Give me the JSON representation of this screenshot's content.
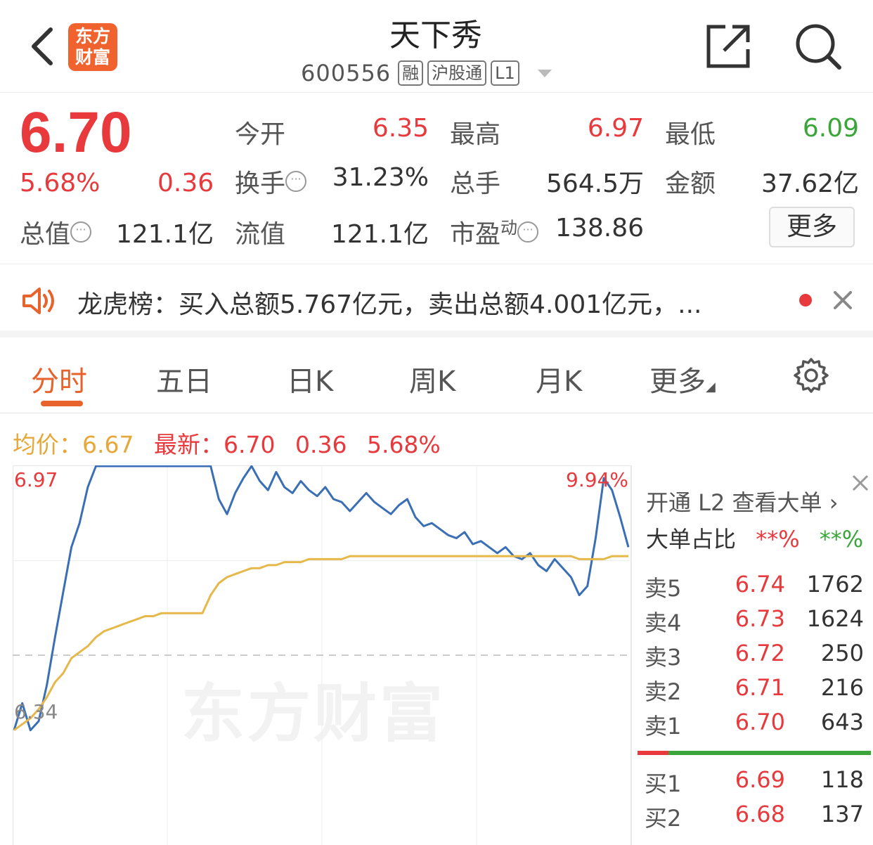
{
  "header": {
    "logo_line1": "东方",
    "logo_line2": "财富",
    "title": "天下秀",
    "code": "600556",
    "tags": [
      "融",
      "沪股通",
      "L1"
    ]
  },
  "quote": {
    "price": "6.70",
    "change_pct": "5.68%",
    "change": "0.36",
    "fields": [
      {
        "label": "今开",
        "value": "6.35",
        "color": "#e8393d"
      },
      {
        "label": "最高",
        "value": "6.97",
        "color": "#e8393d"
      },
      {
        "label": "最低",
        "value": "6.09",
        "color": "#3aa63a"
      },
      {
        "label": "换手",
        "value": "31.23%",
        "color": "#333333"
      },
      {
        "label": "总手",
        "value": "564.5万",
        "color": "#333333"
      },
      {
        "label": "金额",
        "value": "37.62亿",
        "color": "#333333"
      },
      {
        "label": "总值",
        "value": "121.1亿",
        "color": "#333333"
      },
      {
        "label": "流值",
        "value": "121.1亿",
        "color": "#333333"
      },
      {
        "label": "市盈",
        "label_sup": "动",
        "value": "138.86",
        "color": "#333333"
      }
    ],
    "more_label": "更多"
  },
  "banner": {
    "text": "龙虎榜：买入总额5.767亿元，卖出总额4.001亿元，..."
  },
  "tabs": {
    "items": [
      "分时",
      "五日",
      "日K",
      "周K",
      "月K",
      "更多"
    ],
    "active": "分时"
  },
  "infoline": {
    "avg_label": "均价：",
    "avg_value": "6.67",
    "latest_label": "最新：",
    "latest_value": "6.70",
    "latest_change": "0.36",
    "latest_pct": "5.68%"
  },
  "chart_data": {
    "type": "line",
    "top_label": "6.97",
    "top_pct_label": "9.94%",
    "base_label": "6.34",
    "watermark": "东方财富",
    "ylim": [
      5.71,
      6.97
    ],
    "prev_close": 6.34,
    "series": [
      {
        "color": "#3a6fb5",
        "values": [
          6.09,
          6.18,
          6.09,
          6.12,
          6.24,
          6.4,
          6.55,
          6.7,
          6.78,
          6.9,
          6.97,
          6.97,
          6.97,
          6.97,
          6.97,
          6.97,
          6.97,
          6.97,
          6.97,
          6.97,
          6.97,
          6.97,
          6.97,
          6.97,
          6.97,
          6.86,
          6.81,
          6.88,
          6.93,
          6.97,
          6.92,
          6.89,
          6.95,
          6.9,
          6.88,
          6.92,
          6.89,
          6.87,
          6.9,
          6.86,
          6.85,
          6.82,
          6.85,
          6.88,
          6.85,
          6.83,
          6.81,
          6.84,
          6.86,
          6.8,
          6.77,
          6.78,
          6.76,
          6.74,
          6.73,
          6.75,
          6.71,
          6.72,
          6.7,
          6.68,
          6.7,
          6.67,
          6.66,
          6.68,
          6.64,
          6.62,
          6.66,
          6.63,
          6.6,
          6.54,
          6.57,
          6.73,
          6.93,
          6.89,
          6.8,
          6.7
        ]
      },
      {
        "color": "#e6b84a",
        "values": [
          6.09,
          6.11,
          6.13,
          6.16,
          6.2,
          6.25,
          6.28,
          6.33,
          6.35,
          6.37,
          6.4,
          6.42,
          6.43,
          6.44,
          6.45,
          6.46,
          6.47,
          6.47,
          6.48,
          6.48,
          6.48,
          6.48,
          6.48,
          6.48,
          6.54,
          6.58,
          6.6,
          6.61,
          6.62,
          6.63,
          6.63,
          6.64,
          6.64,
          6.65,
          6.65,
          6.65,
          6.66,
          6.66,
          6.66,
          6.66,
          6.66,
          6.67,
          6.67,
          6.67,
          6.67,
          6.67,
          6.67,
          6.67,
          6.67,
          6.67,
          6.67,
          6.67,
          6.67,
          6.67,
          6.67,
          6.67,
          6.67,
          6.67,
          6.67,
          6.67,
          6.67,
          6.67,
          6.67,
          6.67,
          6.67,
          6.67,
          6.67,
          6.67,
          6.67,
          6.66,
          6.66,
          6.66,
          6.66,
          6.67,
          6.67,
          6.67
        ]
      }
    ]
  },
  "orderbook": {
    "l2_text": "开通 L2 查看大单 ›",
    "big_label": "大单占比",
    "big_buy": "**%",
    "big_sell": "**%",
    "asks": [
      {
        "label": "卖5",
        "price": "6.74",
        "volume": "1762"
      },
      {
        "label": "卖4",
        "price": "6.73",
        "volume": "1624"
      },
      {
        "label": "卖3",
        "price": "6.72",
        "volume": "250"
      },
      {
        "label": "卖2",
        "price": "6.71",
        "volume": "216"
      },
      {
        "label": "卖1",
        "price": "6.70",
        "volume": "643"
      }
    ],
    "bids": [
      {
        "label": "买1",
        "price": "6.69",
        "volume": "118"
      },
      {
        "label": "买2",
        "price": "6.68",
        "volume": "137"
      }
    ]
  }
}
